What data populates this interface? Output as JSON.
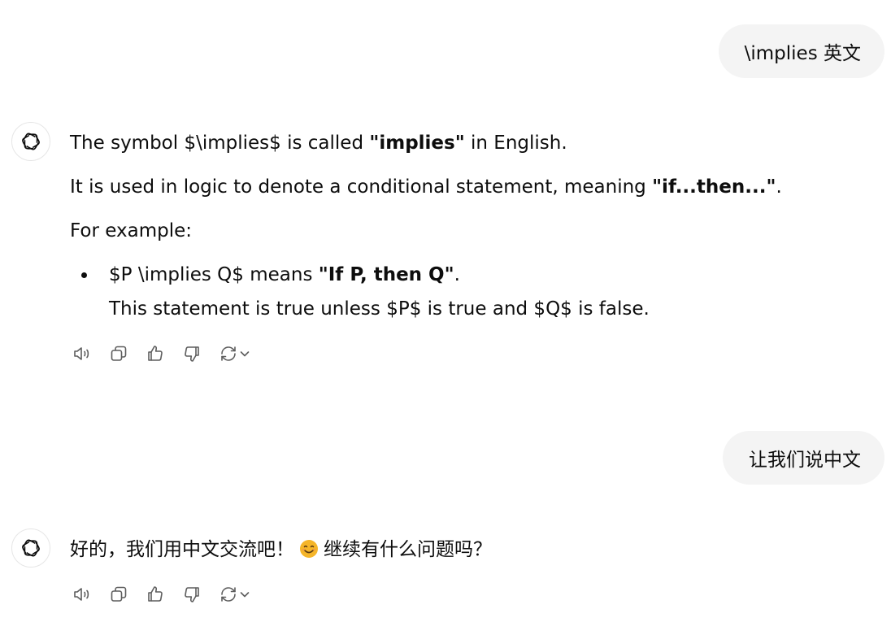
{
  "conversation": {
    "user_message_1": "\\implies 英文",
    "assistant_1": {
      "p1_a": "The symbol $\\implies$ is called ",
      "p1_b": "\"implies\"",
      "p1_c": " in English.",
      "p2_a": "It is used in logic to denote a conditional statement, meaning ",
      "p2_b": "\"if...then...\"",
      "p2_c": ".",
      "p3": "For example:",
      "bullet_a": "$P \\implies Q$ means ",
      "bullet_b": "\"If P, then Q\"",
      "bullet_c": ".",
      "bullet_line2": "This statement is true unless $P$ is true and $Q$ is false."
    },
    "user_message_2": "让我们说中文",
    "assistant_2": {
      "text_a": "好的，我们用中文交流吧！",
      "emoji": "smiling-face-emoji",
      "text_b": "继续有什么问题吗？"
    }
  },
  "icons": {
    "avatar": "openai-logo-icon",
    "read_aloud": "speaker-icon",
    "copy": "copy-icon",
    "like": "thumbs-up-icon",
    "dislike": "thumbs-down-icon",
    "regenerate": "refresh-icon",
    "model_menu": "chevron-down-icon"
  },
  "colors": {
    "user_bubble_bg": "#f4f4f4",
    "text": "#0d0d0d",
    "icon": "#5d5d5d",
    "emoji": "#f5b529"
  }
}
